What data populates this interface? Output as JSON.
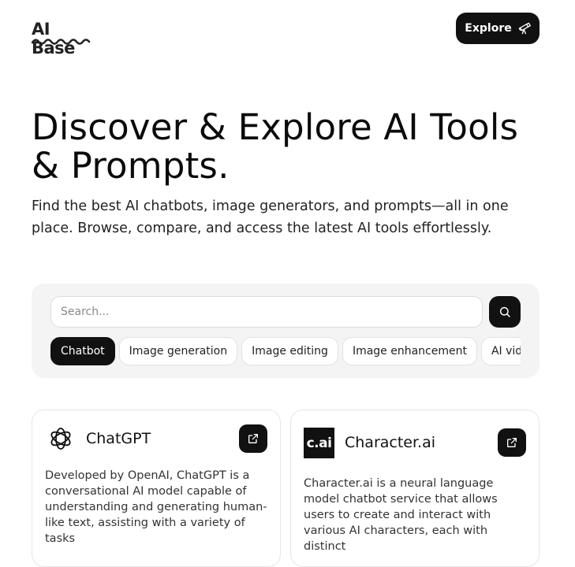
{
  "header": {
    "logo_text": "AI Base",
    "explore_label": "Explore"
  },
  "hero": {
    "title": "Discover & Explore AI Tools & Prompts.",
    "subtitle": "Find the best AI chatbots, image generators, and prompts—all in one place. Browse, compare, and access the latest AI tools effortlessly."
  },
  "search": {
    "placeholder": "Search...",
    "categories": [
      {
        "label": "Chatbot",
        "active": true
      },
      {
        "label": "Image generation",
        "active": false
      },
      {
        "label": "Image editing",
        "active": false
      },
      {
        "label": "Image enhancement",
        "active": false
      },
      {
        "label": "AI video",
        "active": false
      }
    ]
  },
  "tools": [
    {
      "name": "ChatGPT",
      "icon": "openai-logo-icon",
      "description": "Developed by OpenAI, ChatGPT is a conversational AI model capable of understanding and generating human-like text, assisting with a variety of tasks"
    },
    {
      "name": "Character.ai",
      "icon": "character-ai-logo",
      "logo_text": "c.ai",
      "description": "Character.ai is a neural language model chatbot service that allows users to create and interact with various AI characters, each with distinct"
    }
  ],
  "colors": {
    "primary": "#111111",
    "panel": "#f4f4f4",
    "border": "#e6e6e6"
  }
}
